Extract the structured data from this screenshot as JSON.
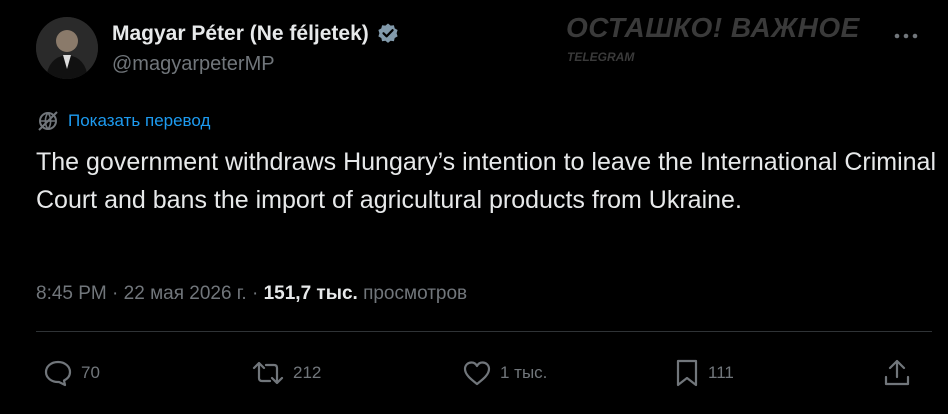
{
  "author": {
    "display_name": "Magyar Péter (Ne féljetek)",
    "handle": "@magyarpeterMP",
    "verified": true
  },
  "watermark": {
    "title": "ОСТАШКО! ВАЖНОЕ",
    "subtitle": "TELEGRAM"
  },
  "translate_label": "Показать перевод",
  "tweet_text": "The government withdraws Hungary’s intention to leave the International Criminal Court and bans the import of agricultural products from Ukraine.",
  "meta": {
    "time": "8:45 PM",
    "date": "22 мая 2026 г.",
    "views_count": "151,7 тыс.",
    "views_label": "просмотров"
  },
  "actions": {
    "replies": "70",
    "reposts": "212",
    "likes": "1 тыс.",
    "bookmarks": "111"
  },
  "colors": {
    "background": "#000000",
    "text": "#e7e9ea",
    "muted": "#71767b",
    "accent": "#1d9bf0"
  },
  "icons": [
    "more-icon",
    "translate-icon",
    "verified-badge-icon",
    "reply-icon",
    "repost-icon",
    "like-icon",
    "bookmark-icon",
    "share-icon"
  ]
}
